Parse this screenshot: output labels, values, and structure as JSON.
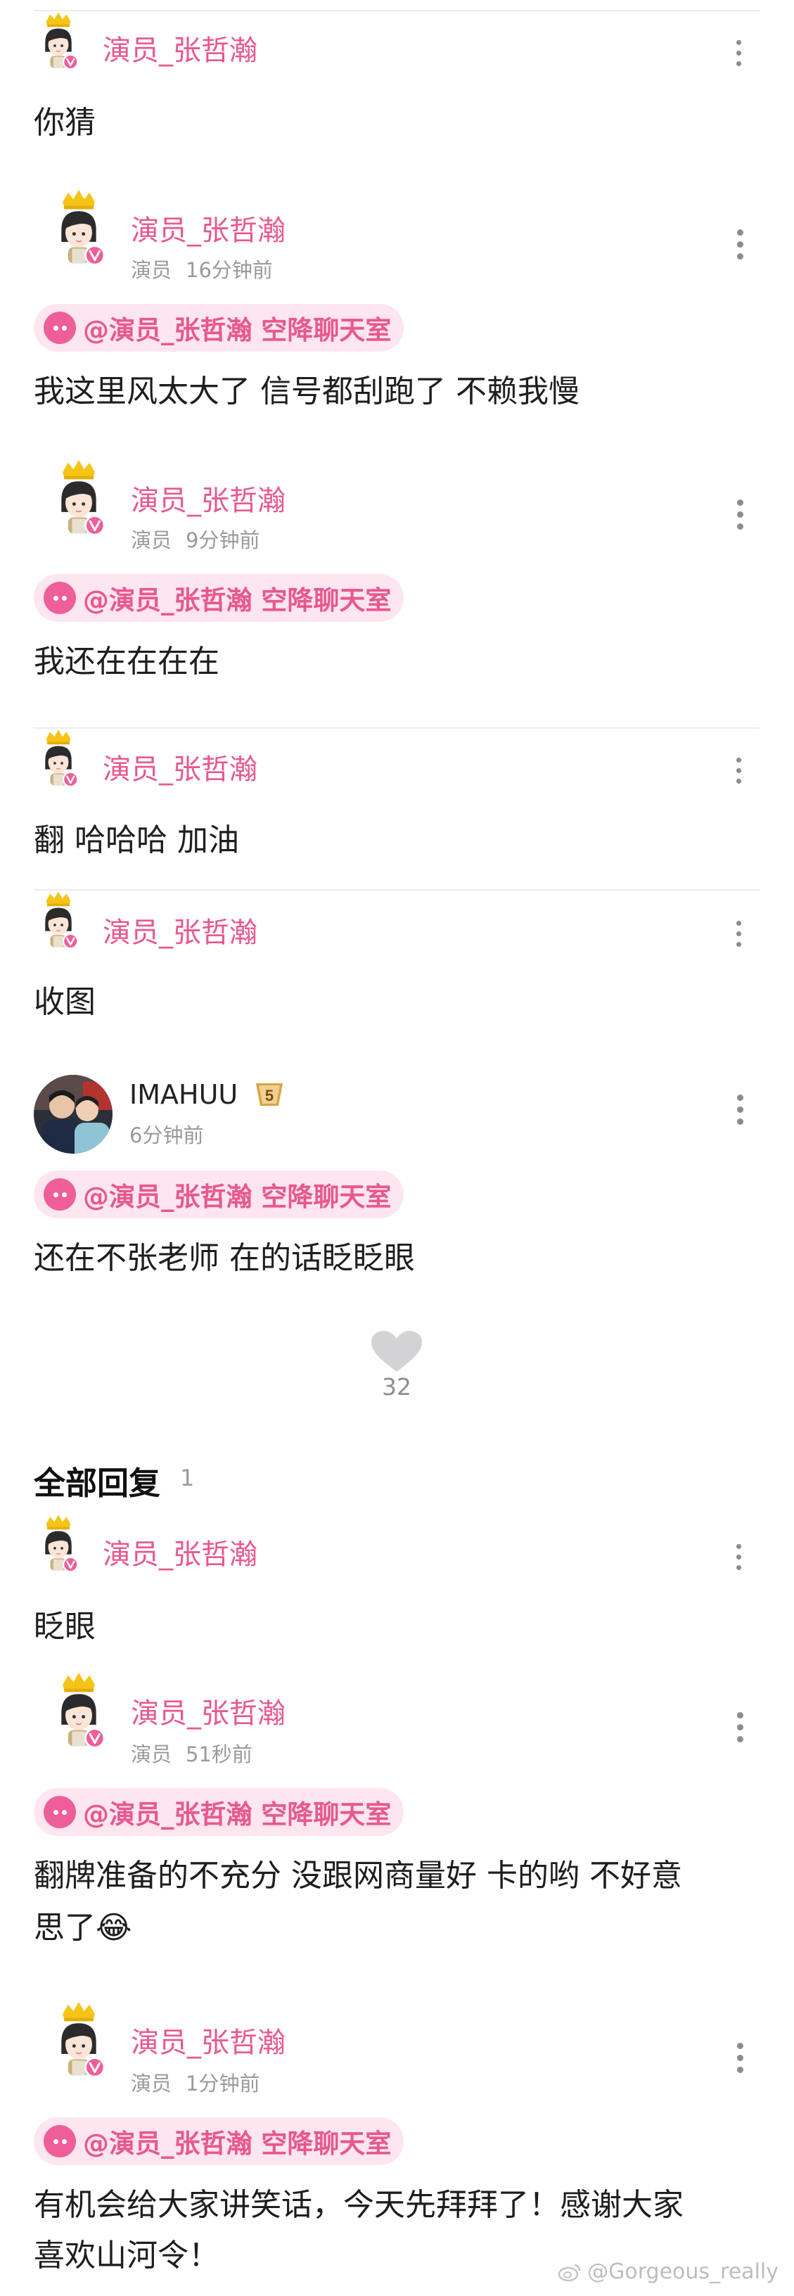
{
  "comments": [
    {
      "user": "演员_张哲瀚",
      "text": "你猜"
    },
    {
      "user": "演员_张哲瀚",
      "role": "演员",
      "time": "16分钟前",
      "tag": "@演员_张哲瀚 空降聊天室",
      "text": "我这里风太大了 信号都刮跑了 不赖我慢"
    },
    {
      "user": "演员_张哲瀚",
      "role": "演员",
      "time": "9分钟前",
      "tag": "@演员_张哲瀚 空降聊天室",
      "text": "我还在在在在"
    },
    {
      "user": "演员_张哲瀚",
      "text": "翻 哈哈哈 加油"
    },
    {
      "user": "演员_张哲瀚",
      "text": "收图"
    },
    {
      "user": "IMAHUU",
      "level": "5",
      "time": "6分钟前",
      "tag": "@演员_张哲瀚 空降聊天室",
      "text": "还在不张老师 在的话眨眨眼"
    }
  ],
  "likes": {
    "count": "32"
  },
  "replies_section": {
    "title": "全部回复",
    "count": "1"
  },
  "replies": [
    {
      "user": "演员_张哲瀚",
      "text": "眨眼"
    },
    {
      "user": "演员_张哲瀚",
      "role": "演员",
      "time": "51秒前",
      "tag": "@演员_张哲瀚 空降聊天室",
      "text_line1": "翻牌准备的不充分 没跟网商量好 卡的哟 不好意",
      "text_line2": "思了😂"
    },
    {
      "user": "演员_张哲瀚",
      "role": "演员",
      "time": "1分钟前",
      "tag": "@演员_张哲瀚 空降聊天室",
      "text_line1": "有机会给大家讲笑话，今天先拜拜了！感谢大家",
      "text_line2": "喜欢山河令！"
    }
  ],
  "watermark": "@Gorgeous_really",
  "colors": {
    "accent": "#e8588f",
    "tag_bg": "#fde6f0",
    "badge": "#ee5e98",
    "crown": "#f5c417"
  }
}
